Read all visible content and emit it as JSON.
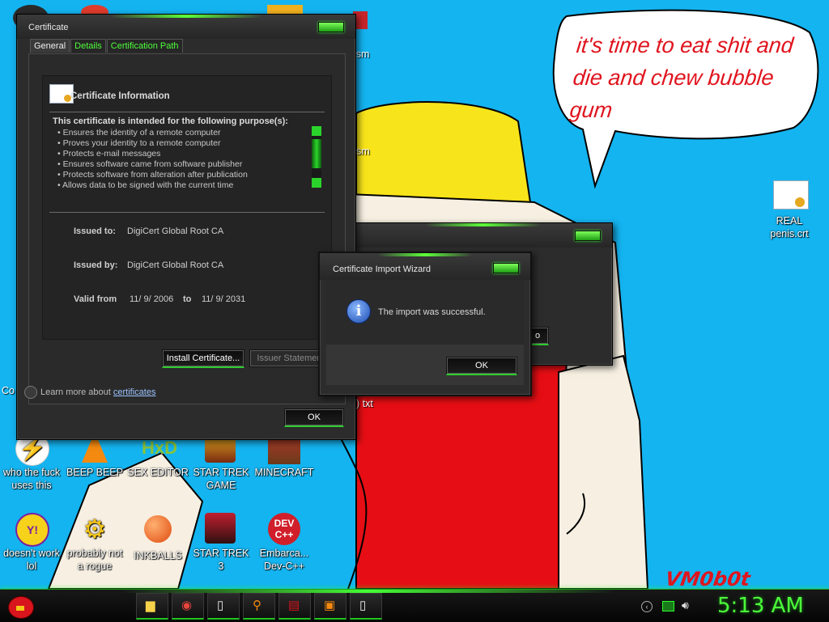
{
  "desktop": {
    "speech_bubble_text": "it's time to eat shit and die and chew bubble gum",
    "watermark": "VM0b0t",
    "icons": [
      {
        "name": "who-the-fuck-uses-this",
        "label": "who the fuck uses this",
        "icon": "lightning-icon"
      },
      {
        "name": "beep-beep",
        "label": "BEEP BEEP",
        "icon": "traffic-cone-icon"
      },
      {
        "name": "sex-editor",
        "label": "SEX EDITOR",
        "icon": "hex-editor-icon"
      },
      {
        "name": "star-trek-game",
        "label": "STAR TREK GAME",
        "icon": "star-wars-icon"
      },
      {
        "name": "minecraft",
        "label": "MINECRAFT",
        "icon": "minecraft-icon"
      },
      {
        "name": "doesnt-work-lol",
        "label": "doesn't work lol",
        "icon": "yahoo-messenger-icon"
      },
      {
        "name": "probably-not-a-rogue",
        "label": "probably not a rogue",
        "icon": "gears-icon"
      },
      {
        "name": "inkballs",
        "label": "INKBALLS",
        "icon": "inkball-icon"
      },
      {
        "name": "star-trek-3",
        "label": "STAR TREK 3",
        "icon": "star-wars-icon"
      },
      {
        "name": "embarcadero-dev-cpp",
        "label": "Embarca... Dev-C++",
        "icon": "dev-cpp-icon"
      },
      {
        "name": "real-penis-crt",
        "label": "REAL penis.crt",
        "icon": "certificate-file-icon"
      }
    ],
    "partial_labels": {
      "ism1": "nism",
      "ism2": "sm",
      "co": "Co",
      "txt": ") txt"
    }
  },
  "cert_dialog": {
    "title": "Certificate",
    "tabs": [
      "General",
      "Details",
      "Certification Path"
    ],
    "info_heading": "Certificate Information",
    "purpose_heading": "This certificate is intended for the following purpose(s):",
    "purposes": [
      "Ensures the identity of a remote computer",
      "Proves your identity to a remote computer",
      "Protects e-mail messages",
      "Ensures software came from software publisher",
      "Protects software from alteration after publication",
      "Allows data to be signed with the current time"
    ],
    "issued_to_label": "Issued to:",
    "issued_to": "DigiCert Global Root CA",
    "issued_by_label": "Issued by:",
    "issued_by": "DigiCert Global Root CA",
    "valid_from_label": "Valid from",
    "valid_from": "11/ 9/ 2006",
    "to_label": "to",
    "valid_to": "11/ 9/ 2031",
    "install_button": "Install Certificate...",
    "issuer_button": "Issuer Statement",
    "learn_more_prefix": "Learn more about",
    "learn_more_link": "certificates",
    "ok_button": "OK"
  },
  "wizard_dialog": {
    "title": "Certificate Import Wizard",
    "message": "The import was successful.",
    "ok_button": "OK",
    "behind_button_fragment": "o"
  },
  "taskbar": {
    "items": [
      "file-explorer-icon",
      "chrome-icon",
      "document-icon",
      "search-icon",
      "archive-icon",
      "notepad-icon",
      "document-icon"
    ],
    "tray": [
      "back-arrow-icon",
      "network-icon",
      "speaker-icon"
    ],
    "clock": "5:13 AM"
  },
  "colors": {
    "accent": "#2ecc2e",
    "desktop_bg": "#14b4f0",
    "bubble_text": "#e0141e"
  }
}
